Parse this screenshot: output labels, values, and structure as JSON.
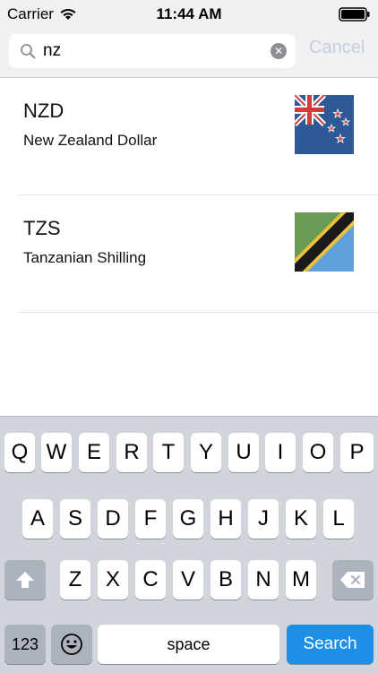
{
  "status_bar": {
    "carrier": "Carrier",
    "time": "11:44 AM"
  },
  "search": {
    "value": "nz",
    "cancel_label": "Cancel"
  },
  "results": [
    {
      "code": "NZD",
      "name": "New Zealand Dollar",
      "flag_icon": "new-zealand-flag-icon"
    },
    {
      "code": "TZS",
      "name": "Tanzanian Shilling",
      "flag_icon": "tanzania-flag-icon"
    }
  ],
  "keyboard": {
    "row1": [
      "Q",
      "W",
      "E",
      "R",
      "T",
      "Y",
      "U",
      "I",
      "O",
      "P"
    ],
    "row2": [
      "A",
      "S",
      "D",
      "F",
      "G",
      "H",
      "J",
      "K",
      "L"
    ],
    "row3": [
      "Z",
      "X",
      "C",
      "V",
      "B",
      "N",
      "M"
    ],
    "numbers_label": "123",
    "space_label": "space",
    "search_label": "Search"
  },
  "colors": {
    "accent": "#1e8fe6",
    "cancel_text": "#c3cfe0"
  }
}
